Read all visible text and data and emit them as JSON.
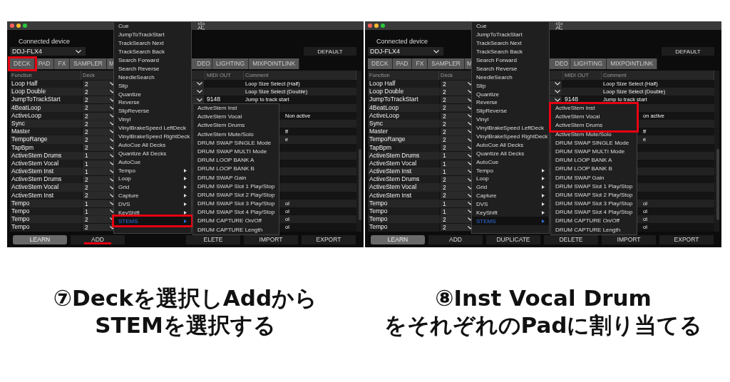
{
  "panels": [
    {
      "title_fragment": "定",
      "device_label": "Connected device",
      "device": "DDJ-FLX4",
      "default_button": "DEFAULT",
      "tabs": [
        {
          "label": "DECK",
          "kind": "full",
          "highlighted": true
        },
        {
          "label": "PAD",
          "kind": "full",
          "highlighted": false
        },
        {
          "label": "FX",
          "kind": "full",
          "highlighted": false
        },
        {
          "label": "SAMPLER",
          "kind": "full",
          "highlighted": false
        },
        {
          "label": "M",
          "kind": "cut_right",
          "highlighted": false
        },
        {
          "label": "DEO",
          "kind": "cut_left",
          "highlighted": false
        },
        {
          "label": "LIGHTING",
          "kind": "full",
          "highlighted": false
        },
        {
          "label": "MIXPOINTLINK",
          "kind": "full",
          "highlighted": false
        }
      ],
      "column_headers": {
        "function": "Function",
        "deck": "Deck",
        "midi_out": "MIDI OUT",
        "comment": "Comment"
      },
      "rows": [
        {
          "function": "Loop Half",
          "deck": "2",
          "column_3_dropdown": true,
          "comment": "Loop Size Select (Half)"
        },
        {
          "function": "Loop Double",
          "deck": "2",
          "column_3_dropdown": true,
          "comment": "Loop Size Select (Double)"
        },
        {
          "function": "JumpToTrackStart",
          "deck": "2",
          "column_3_dropdown": true,
          "midi_out": "9148",
          "comment": "Jump to track start"
        },
        {
          "function": "4BeatLoop",
          "deck": "2",
          "column_3_dropdown": false
        },
        {
          "function": "ActiveLoop",
          "deck": "2",
          "column_3_dropdown": false,
          "comment_tail": "Non active"
        },
        {
          "function": "Sync",
          "deck": "2",
          "column_3_dropdown": false
        },
        {
          "function": "Master",
          "deck": "2",
          "column_3_dropdown": false,
          "comment_tail": "ff"
        },
        {
          "function": "TempoRange",
          "deck": "2",
          "column_3_dropdown": false,
          "comment_tail": "e"
        },
        {
          "function": "TapBpm",
          "deck": "2",
          "column_3_dropdown": false
        },
        {
          "function": "ActiveStem Drums",
          "deck": "1",
          "column_3_dropdown": false
        },
        {
          "function": "ActiveStem Vocal",
          "deck": "1",
          "column_3_dropdown": false
        },
        {
          "function": "ActiveStem Inst",
          "deck": "1",
          "column_3_dropdown": false
        },
        {
          "function": "ActiveStem Drums",
          "deck": "2",
          "column_3_dropdown": false
        },
        {
          "function": "ActiveStem Vocal",
          "deck": "2",
          "column_3_dropdown": false
        },
        {
          "function": "ActiveStem Inst",
          "deck": "2",
          "column_3_dropdown": false
        },
        {
          "function": "Tempo",
          "deck": "1",
          "column_3_dropdown": false,
          "comment_tail": "ol"
        },
        {
          "function": "Tempo",
          "deck": "1",
          "column_3_dropdown": false,
          "comment_tail": "ol"
        },
        {
          "function": "Tempo",
          "deck": "2",
          "column_3_dropdown": false,
          "comment_tail": "ol"
        },
        {
          "function": "Tempo",
          "deck": "2",
          "column_3_dropdown": false,
          "comment_tail": "ol"
        }
      ],
      "buttons": [
        {
          "label": "LEARN",
          "kind": "learn",
          "underlined": false
        },
        {
          "label": "ADD",
          "kind": "plain",
          "underlined": true
        },
        {
          "kind": "covered"
        },
        {
          "label": "ELETE",
          "kind": "plain",
          "underlined": false
        },
        {
          "label": "IMPORT",
          "kind": "plain",
          "underlined": false
        },
        {
          "label": "EXPORT",
          "kind": "plain",
          "underlined": false
        }
      ],
      "menu": [
        {
          "label": "Cue",
          "has_submenu": false,
          "selected": false,
          "highlighted": false
        },
        {
          "label": "JumpToTrackStart",
          "has_submenu": false,
          "selected": false,
          "highlighted": false
        },
        {
          "label": "TrackSearch Next",
          "has_submenu": false,
          "selected": false,
          "highlighted": false
        },
        {
          "label": "TrackSearch Back",
          "has_submenu": false,
          "selected": false,
          "highlighted": false
        },
        {
          "label": "Search Forward",
          "has_submenu": false,
          "selected": false,
          "highlighted": false
        },
        {
          "label": "Search Reverse",
          "has_submenu": false,
          "selected": false,
          "highlighted": false
        },
        {
          "label": "NeedleSearch",
          "has_submenu": false,
          "selected": false,
          "highlighted": false
        },
        {
          "label": "Slip",
          "has_submenu": false,
          "selected": false,
          "highlighted": false
        },
        {
          "label": "Quantize",
          "has_submenu": false,
          "selected": false,
          "highlighted": false
        },
        {
          "label": "Reverse",
          "has_submenu": false,
          "selected": false,
          "highlighted": false
        },
        {
          "label": "SlipReverse",
          "has_submenu": false,
          "selected": false,
          "highlighted": false
        },
        {
          "label": "Vinyl",
          "has_submenu": false,
          "selected": false,
          "highlighted": false
        },
        {
          "label": "VinylBrakeSpeed LeftDeck",
          "has_submenu": false,
          "selected": false,
          "highlighted": false
        },
        {
          "label": "VinylBrakeSpeed RightDeck",
          "has_submenu": false,
          "selected": false,
          "highlighted": false
        },
        {
          "label": "AutoCue All Decks",
          "has_submenu": false,
          "selected": false,
          "highlighted": false
        },
        {
          "label": "Quantize All Decks",
          "has_submenu": false,
          "selected": false,
          "highlighted": false
        },
        {
          "label": "AutoCue",
          "has_submenu": false,
          "selected": false,
          "highlighted": false
        },
        {
          "label": "Tempo",
          "has_submenu": true,
          "selected": false,
          "highlighted": false
        },
        {
          "label": "Loop",
          "has_submenu": true,
          "selected": false,
          "highlighted": false
        },
        {
          "label": "Grid",
          "has_submenu": true,
          "selected": false,
          "highlighted": false
        },
        {
          "label": "Capture",
          "has_submenu": true,
          "selected": false,
          "highlighted": false
        },
        {
          "label": "DVS",
          "has_submenu": true,
          "selected": false,
          "highlighted": false
        },
        {
          "label": "KeyShift",
          "has_submenu": true,
          "selected": false,
          "highlighted": false
        },
        {
          "label": "STEMS",
          "has_submenu": true,
          "selected": true,
          "highlighted": true
        }
      ],
      "submenu": [
        {
          "label": "ActiveStem Inst",
          "highlighted": false
        },
        {
          "label": "ActiveStem Vocal",
          "highlighted": false
        },
        {
          "label": "ActiveStem Drums",
          "highlighted": false
        },
        {
          "label": "ActiveStem Mute/Solo",
          "highlighted": false
        },
        {
          "label": "DRUM SWAP SINGLE Mode",
          "highlighted": false
        },
        {
          "label": "DRUM SWAP MULTI Mode",
          "highlighted": false
        },
        {
          "label": "DRUM LOOP BANK A",
          "highlighted": false
        },
        {
          "label": "DRUM LOOP BANK B",
          "highlighted": false
        },
        {
          "label": "DRUM SWAP Gain",
          "highlighted": false
        },
        {
          "label": "DRUM SWAP Slot 1 Play/Stop",
          "highlighted": false
        },
        {
          "label": "DRUM SWAP Slot 2 Play/Stop",
          "highlighted": false
        },
        {
          "label": "DRUM SWAP Slot 3 Play/Stop",
          "highlighted": false
        },
        {
          "label": "DRUM SWAP Slot 4 Play/Stop",
          "highlighted": false
        },
        {
          "label": "DRUM CAPTURE On/Off",
          "highlighted": false
        },
        {
          "label": "DRUM CAPTURE Length",
          "highlighted": false
        }
      ],
      "caption": [
        "⑦Deckを選択しAddから",
        "STEMを選択する"
      ]
    },
    {
      "title_fragment": "定",
      "device_label": "Connected device",
      "device": "DDJ-FLX4",
      "default_button": "DEFAULT",
      "tabs": [
        {
          "label": "DECK",
          "kind": "full",
          "highlighted": false
        },
        {
          "label": "PAD",
          "kind": "full",
          "highlighted": false
        },
        {
          "label": "FX",
          "kind": "full",
          "highlighted": false
        },
        {
          "label": "SAMPLER",
          "kind": "full",
          "highlighted": false
        },
        {
          "label": "M",
          "kind": "cut_right",
          "highlighted": false
        },
        {
          "label": "DEO",
          "kind": "cut_left",
          "highlighted": false
        },
        {
          "label": "LIGHTING",
          "kind": "full",
          "highlighted": false
        },
        {
          "label": "MIXPOINTLINK",
          "kind": "full",
          "highlighted": false
        }
      ],
      "column_headers": {
        "function": "Function",
        "deck": "Deck",
        "midi_out": "MIDI OUT",
        "comment": "Comment"
      },
      "rows": [
        {
          "function": "Loop Half",
          "deck": "2",
          "column_3_dropdown": true,
          "comment": "Loop Size Select (Half)"
        },
        {
          "function": "Loop Double",
          "deck": "2",
          "column_3_dropdown": true,
          "comment": "Loop Size Select (Double)"
        },
        {
          "function": "JumpToTrackStart",
          "deck": "2",
          "column_3_dropdown": true,
          "midi_out": "9148",
          "comment": "Jump to track start"
        },
        {
          "function": "4BeatLoop",
          "deck": "2",
          "column_3_dropdown": false
        },
        {
          "function": "ActiveLoop",
          "deck": "2",
          "column_3_dropdown": false,
          "comment_tail": "on active"
        },
        {
          "function": "Sync",
          "deck": "2",
          "column_3_dropdown": false
        },
        {
          "function": "Master",
          "deck": "2",
          "column_3_dropdown": false,
          "comment_tail": "ff"
        },
        {
          "function": "TempoRange",
          "deck": "2",
          "column_3_dropdown": false,
          "comment_tail": "e"
        },
        {
          "function": "TapBpm",
          "deck": "2",
          "column_3_dropdown": false
        },
        {
          "function": "ActiveStem Drums",
          "deck": "1",
          "column_3_dropdown": false
        },
        {
          "function": "ActiveStem Vocal",
          "deck": "1",
          "column_3_dropdown": false
        },
        {
          "function": "ActiveStem Inst",
          "deck": "1",
          "column_3_dropdown": false
        },
        {
          "function": "ActiveStem Drums",
          "deck": "2",
          "column_3_dropdown": false
        },
        {
          "function": "ActiveStem Vocal",
          "deck": "2",
          "column_3_dropdown": false
        },
        {
          "function": "ActiveStem Inst",
          "deck": "2",
          "column_3_dropdown": false
        },
        {
          "function": "Tempo",
          "deck": "1",
          "column_3_dropdown": false,
          "comment_tail": "ol"
        },
        {
          "function": "Tempo",
          "deck": "1",
          "column_3_dropdown": false,
          "comment_tail": "ol"
        },
        {
          "function": "Tempo",
          "deck": "2",
          "column_3_dropdown": false,
          "comment_tail": "ol"
        },
        {
          "function": "Tempo",
          "deck": "2",
          "column_3_dropdown": false,
          "comment_tail": "ol"
        }
      ],
      "buttons": [
        {
          "label": "LEARN",
          "kind": "learn",
          "underlined": false
        },
        {
          "label": "ADD",
          "kind": "plain",
          "underlined": false
        },
        {
          "label": "DUPLICATE",
          "kind": "plain",
          "underlined": false
        },
        {
          "label": "DELETE",
          "kind": "plain",
          "underlined": false
        },
        {
          "label": "IMPORT",
          "kind": "plain",
          "underlined": false
        },
        {
          "label": "EXPORT",
          "kind": "plain",
          "underlined": false
        }
      ],
      "menu": [
        {
          "label": "Cue",
          "has_submenu": false,
          "selected": false,
          "highlighted": false
        },
        {
          "label": "JumpToTrackStart",
          "has_submenu": false,
          "selected": false,
          "highlighted": false
        },
        {
          "label": "TrackSearch Next",
          "has_submenu": false,
          "selected": false,
          "highlighted": false
        },
        {
          "label": "TrackSearch Back",
          "has_submenu": false,
          "selected": false,
          "highlighted": false
        },
        {
          "label": "Search Forward",
          "has_submenu": false,
          "selected": false,
          "highlighted": false
        },
        {
          "label": "Search Reverse",
          "has_submenu": false,
          "selected": false,
          "highlighted": false
        },
        {
          "label": "NeedleSearch",
          "has_submenu": false,
          "selected": false,
          "highlighted": false
        },
        {
          "label": "Slip",
          "has_submenu": false,
          "selected": false,
          "highlighted": false
        },
        {
          "label": "Quantize",
          "has_submenu": false,
          "selected": false,
          "highlighted": false
        },
        {
          "label": "Reverse",
          "has_submenu": false,
          "selected": false,
          "highlighted": false
        },
        {
          "label": "SlipReverse",
          "has_submenu": false,
          "selected": false,
          "highlighted": false
        },
        {
          "label": "Vinyl",
          "has_submenu": false,
          "selected": false,
          "highlighted": false
        },
        {
          "label": "VinylBrakeSpeed LeftDeck",
          "has_submenu": false,
          "selected": false,
          "highlighted": false
        },
        {
          "label": "VinylBrakeSpeed RightDeck",
          "has_submenu": false,
          "selected": false,
          "highlighted": false
        },
        {
          "label": "AutoCue All Decks",
          "has_submenu": false,
          "selected": false,
          "highlighted": false
        },
        {
          "label": "Quantize All Decks",
          "has_submenu": false,
          "selected": false,
          "highlighted": false
        },
        {
          "label": "AutoCue",
          "has_submenu": false,
          "selected": false,
          "highlighted": false
        },
        {
          "label": "Tempo",
          "has_submenu": true,
          "selected": false,
          "highlighted": false
        },
        {
          "label": "Loop",
          "has_submenu": true,
          "selected": false,
          "highlighted": false
        },
        {
          "label": "Grid",
          "has_submenu": true,
          "selected": false,
          "highlighted": false
        },
        {
          "label": "Capture",
          "has_submenu": true,
          "selected": false,
          "highlighted": false
        },
        {
          "label": "DVS",
          "has_submenu": true,
          "selected": false,
          "highlighted": false
        },
        {
          "label": "KeyShift",
          "has_submenu": true,
          "selected": false,
          "highlighted": false
        },
        {
          "label": "STEMS",
          "has_submenu": true,
          "selected": true,
          "highlighted": false
        }
      ],
      "submenu": [
        {
          "label": "ActiveStem Inst",
          "highlighted": true
        },
        {
          "label": "ActiveStem Vocal",
          "highlighted": true
        },
        {
          "label": "ActiveStem Drums",
          "highlighted": true
        },
        {
          "label": "ActiveStem Mute/Solo",
          "highlighted": false
        },
        {
          "label": "DRUM SWAP SINGLE Mode",
          "highlighted": false
        },
        {
          "label": "DRUM SWAP MULTI Mode",
          "highlighted": false
        },
        {
          "label": "DRUM LOOP BANK A",
          "highlighted": false
        },
        {
          "label": "DRUM LOOP BANK B",
          "highlighted": false
        },
        {
          "label": "DRUM SWAP Gain",
          "highlighted": false
        },
        {
          "label": "DRUM SWAP Slot 1 Play/Stop",
          "highlighted": false
        },
        {
          "label": "DRUM SWAP Slot 2 Play/Stop",
          "highlighted": false
        },
        {
          "label": "DRUM SWAP Slot 3 Play/Stop",
          "highlighted": false
        },
        {
          "label": "DRUM SWAP Slot 4 Play/Stop",
          "highlighted": false
        },
        {
          "label": "DRUM CAPTURE On/Off",
          "highlighted": false
        },
        {
          "label": "DRUM CAPTURE Length",
          "highlighted": false
        }
      ],
      "caption": [
        "⑧Inst Vocal Drum",
        "をそれぞれのPadに割り当てる"
      ]
    }
  ]
}
